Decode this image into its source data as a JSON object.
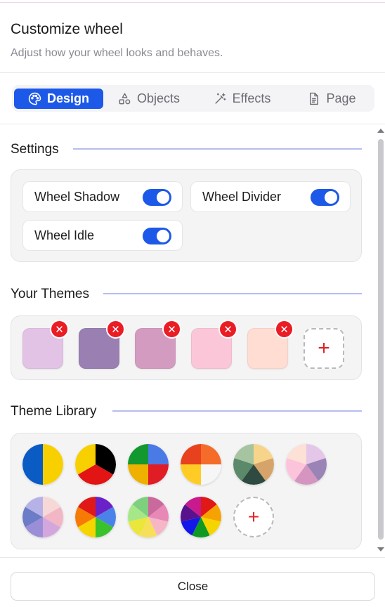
{
  "header": {
    "title": "Customize wheel",
    "subtitle": "Adjust how your wheel looks and behaves."
  },
  "tabs": [
    {
      "label": "Design",
      "icon": "palette-icon",
      "active": true
    },
    {
      "label": "Objects",
      "icon": "shapes-icon",
      "active": false
    },
    {
      "label": "Effects",
      "icon": "magic-wand-icon",
      "active": false
    },
    {
      "label": "Page",
      "icon": "document-icon",
      "active": false
    }
  ],
  "settings": {
    "title": "Settings",
    "toggles": [
      {
        "label": "Wheel Shadow",
        "on": true
      },
      {
        "label": "Wheel Divider",
        "on": true
      },
      {
        "label": "Wheel Idle",
        "on": true
      }
    ]
  },
  "your_themes": {
    "title": "Your Themes",
    "swatches": [
      "#e2c3e6",
      "#9a80b2",
      "#d49bc0",
      "#fbc7d8",
      "#ffddd2"
    ],
    "add_label": "+"
  },
  "theme_library": {
    "title": "Theme Library",
    "add_label": "+",
    "wheels": [
      [
        "#f8d000",
        "#0a5bc4"
      ],
      [
        "#000000",
        "#e21414",
        "#f8d000"
      ],
      [
        "#4a7ae6",
        "#e01c24",
        "#eeb100",
        "#13972f"
      ],
      [
        "#f46b2a",
        "#f6f6f6",
        "#ffcc26",
        "#e8411e"
      ],
      [
        "#f6d58a",
        "#d6a46a",
        "#2f4a40",
        "#5a8a6a",
        "#a6c4a0"
      ],
      [
        "#e4c6e8",
        "#9a84b6",
        "#d496c0",
        "#fcc4da",
        "#fde0d6"
      ],
      [
        "#f6d8d6",
        "#f2b6c4",
        "#d4a6de",
        "#9a8ed8",
        "#6c7cc6",
        "#b6b2e8"
      ],
      [
        "#6a22c8",
        "#4a82ea",
        "#3ac22a",
        "#f6d400",
        "#f67a06",
        "#e01818"
      ],
      [
        "#ca6a9c",
        "#e888b6",
        "#f6b6c6",
        "#f6e05a",
        "#eae63a",
        "#a6e888",
        "#7ed07e"
      ],
      [
        "#e01818",
        "#f6a200",
        "#f6d400",
        "#0e9a22",
        "#1218e8",
        "#58128c",
        "#c81a8c"
      ]
    ]
  },
  "footer": {
    "close_label": "Close"
  }
}
